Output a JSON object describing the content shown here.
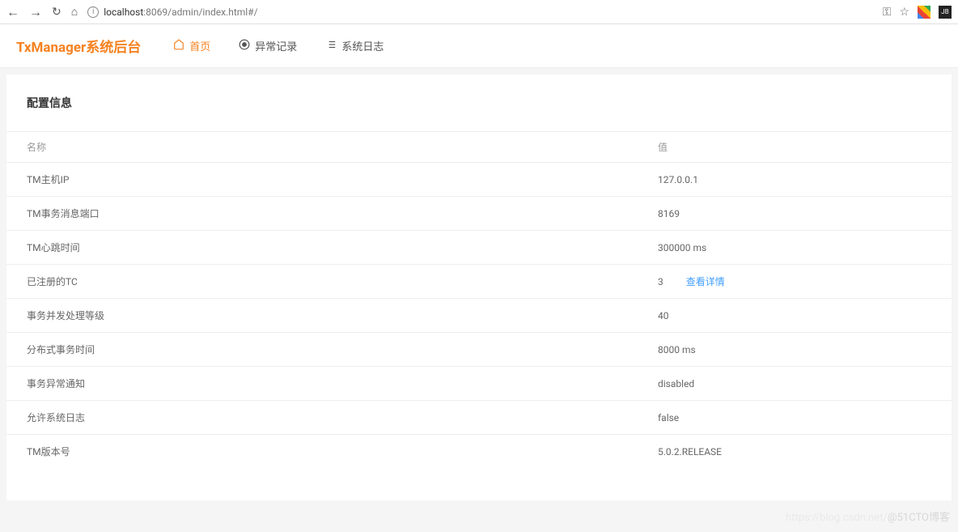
{
  "browser": {
    "url_host": "localhost",
    "url_port_path": ":8069/admin/index.html#/"
  },
  "header": {
    "brand": "TxManager系统后台",
    "nav": {
      "home": "首页",
      "exception": "异常记录",
      "syslog": "系统日志"
    }
  },
  "panel": {
    "title": "配置信息",
    "columns": {
      "name": "名称",
      "value": "值"
    },
    "rows": [
      {
        "name": "TM主机IP",
        "value": "127.0.0.1"
      },
      {
        "name": "TM事务消息端口",
        "value": "8169"
      },
      {
        "name": "TM心跳时间",
        "value": "300000 ms"
      },
      {
        "name": "已注册的TC",
        "value": "3",
        "link": "查看详情"
      },
      {
        "name": "事务并发处理等级",
        "value": "40"
      },
      {
        "name": "分布式事务时间",
        "value": "8000 ms"
      },
      {
        "name": "事务异常通知",
        "value": "disabled"
      },
      {
        "name": "允许系统日志",
        "value": "false"
      },
      {
        "name": "TM版本号",
        "value": "5.0.2.RELEASE"
      }
    ]
  },
  "watermark": {
    "pre": "https://blog.csdn.net/",
    "main": "@51CTO博客"
  }
}
